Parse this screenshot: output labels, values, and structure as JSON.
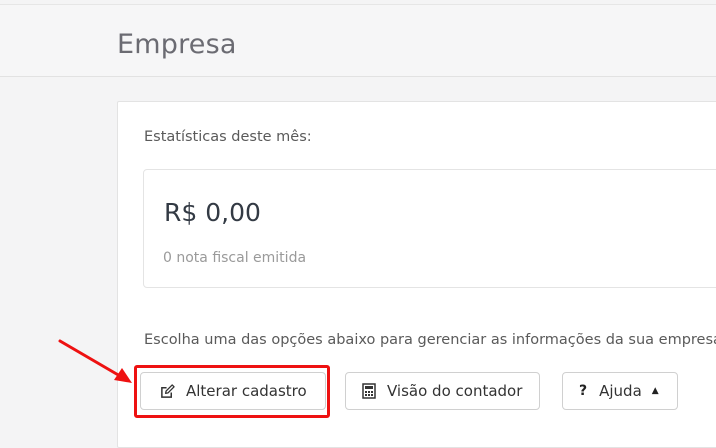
{
  "header": {
    "title": "Empresa"
  },
  "stats": {
    "label": "Estatísticas deste mês:",
    "value": "R$ 0,00",
    "sub": "0 nota fiscal emitida"
  },
  "options": {
    "label": "Escolha uma das opções abaixo para gerenciar as informações da sua empresa:"
  },
  "buttons": {
    "edit": "Alterar cadastro",
    "visao": "Visão do contador",
    "ajuda": "Ajuda"
  },
  "icons": {
    "edit": "edit-icon",
    "calculator": "calculator-icon",
    "help": "question-icon",
    "caret": "caret-up-icon"
  },
  "colors": {
    "highlight": "#e11111"
  }
}
